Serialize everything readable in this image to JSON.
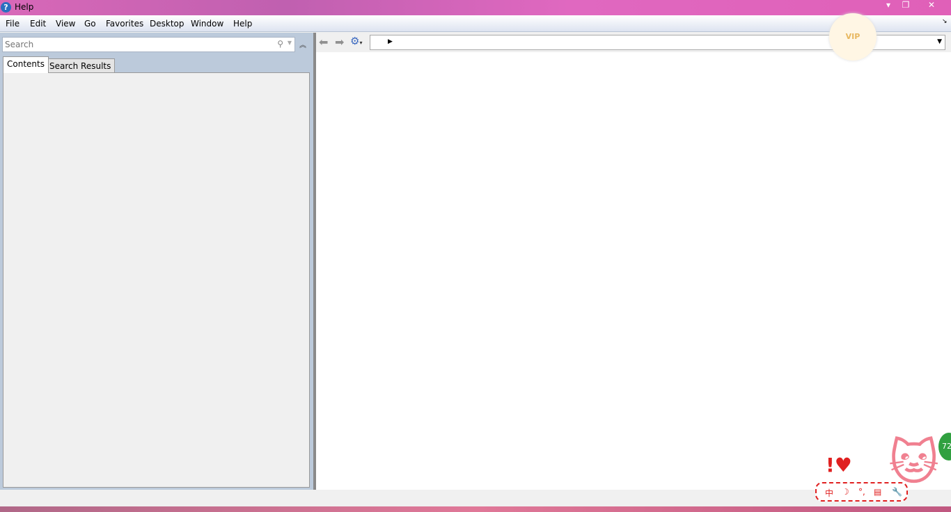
{
  "window": {
    "title": "Help",
    "icon": "help-icon",
    "controls": [
      "minimize-icon",
      "restore-icon",
      "close-icon"
    ]
  },
  "menu": [
    "File",
    "Edit",
    "View",
    "Go",
    "Favorites",
    "Desktop",
    "Window",
    "Help"
  ],
  "left_panel": {
    "search_placeholder": "Search",
    "tabs": [
      {
        "label": "Contents",
        "active": true
      },
      {
        "label": "Search Results",
        "active": false
      }
    ]
  },
  "browser": {
    "address": ""
  },
  "overlays": {
    "vip_label": "VIP",
    "ime_items": [
      "中",
      "☽",
      "°,",
      "▤",
      "🔧"
    ],
    "badge": "72"
  }
}
